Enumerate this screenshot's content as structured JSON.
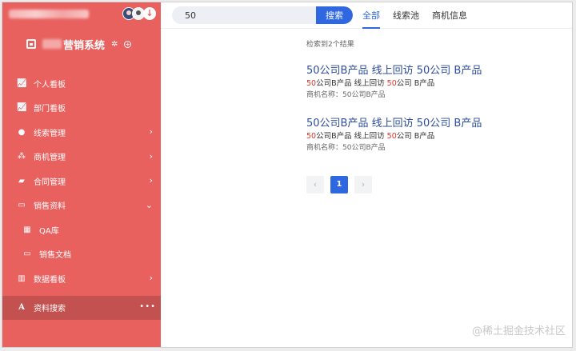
{
  "header": {
    "system_name": "营销系统",
    "download_icon": "download-circle-icon"
  },
  "sidebar": {
    "items": [
      {
        "label": "个人看板",
        "icon": "line-chart-icon",
        "arrow": ""
      },
      {
        "label": "部门看板",
        "icon": "line-chart-icon",
        "arrow": ""
      },
      {
        "label": "线索管理",
        "icon": "user-icon",
        "arrow": "›"
      },
      {
        "label": "商机管理",
        "icon": "users-icon",
        "arrow": "›"
      },
      {
        "label": "合同管理",
        "icon": "book-icon",
        "arrow": "›"
      },
      {
        "label": "销售资料",
        "icon": "folder-open-icon",
        "arrow": "⌄"
      },
      {
        "label": "QA库",
        "icon": "table-icon",
        "arrow": ""
      },
      {
        "label": "销售文档",
        "icon": "folder-open-icon",
        "arrow": ""
      },
      {
        "label": "数据看板",
        "icon": "bar-chart-icon",
        "arrow": "›"
      },
      {
        "label": "资料搜索",
        "icon": "font-icon",
        "arrow": ""
      }
    ],
    "active_more": "•••"
  },
  "search": {
    "value": "50",
    "button_label": "搜索"
  },
  "tabs": [
    {
      "label": "全部"
    },
    {
      "label": "线索池"
    },
    {
      "label": "商机信息"
    }
  ],
  "results": {
    "count_text": "检索到2个结果",
    "items": [
      {
        "title": "50公司B产品 线上回访 50公司 B产品",
        "snippet_hl1": "50",
        "snippet_mid": "公司B产品 线上回访 ",
        "snippet_hl2": "50",
        "snippet_end": "公司 B产品",
        "meta": "商机名称：50公司B产品"
      },
      {
        "title": "50公司B产品 线上回访 50公司 B产品",
        "snippet_hl1": "50",
        "snippet_mid": "公司B产品 线上回访 ",
        "snippet_hl2": "50",
        "snippet_end": "公司 B产品",
        "meta": "商机名称：50公司B产品"
      }
    ]
  },
  "pagination": {
    "prev": "‹",
    "current": "1",
    "next": "›"
  },
  "watermark": "@稀土掘金技术社区",
  "colors": {
    "sidebar_bg": "#e8615f",
    "sidebar_active": "#c3514f",
    "accent": "#2f67e1",
    "highlight": "#e0342c",
    "link": "#2d4d9c"
  }
}
